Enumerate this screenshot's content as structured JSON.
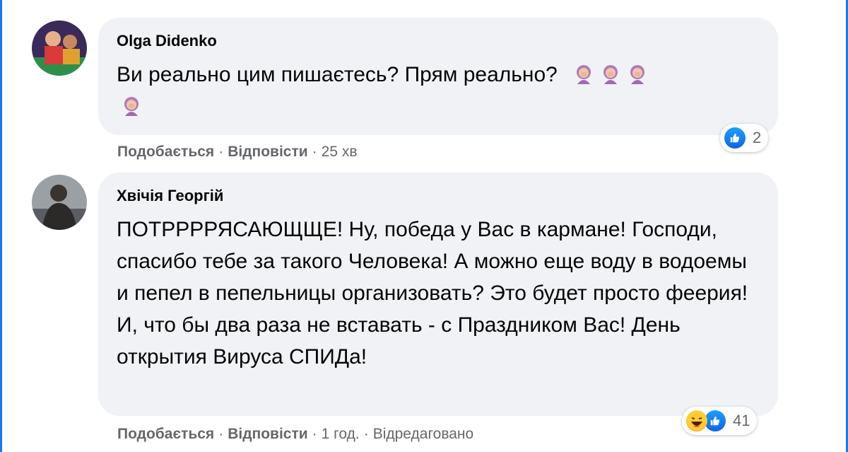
{
  "comments": [
    {
      "author": "Olga Didenko",
      "text": "Ви реально цим пишаєтесь? Прям реально?",
      "emoji_icons": [
        "woman-facepalming-icon",
        "woman-facepalming-icon",
        "woman-facepalming-icon",
        "woman-facepalming-icon"
      ],
      "actions": {
        "like": "Подобається",
        "reply": "Відповісти",
        "time": "25 хв",
        "edited": ""
      },
      "reactions": {
        "icons": [
          "like-icon"
        ],
        "count": "2"
      }
    },
    {
      "author": "Хвічія Георгій",
      "text": "ПОТРРРРЯСАЮЩЩЕ! Ну, победа у Вас в кармане! Господи, спасибо тебе за такого Человека! А можно еще воду в водоемы и пепел в пепельницы организовать? Это будет просто феерия! И, что бы два раза не вставать - с Праздником Вас! День открытия Вируса СПИДа!",
      "actions": {
        "like": "Подобається",
        "reply": "Відповісти",
        "time": "1 год.",
        "edited": "Відредаговано"
      },
      "reactions": {
        "icons": [
          "haha-icon",
          "like-icon"
        ],
        "count": "41"
      }
    }
  ],
  "separator": "·"
}
